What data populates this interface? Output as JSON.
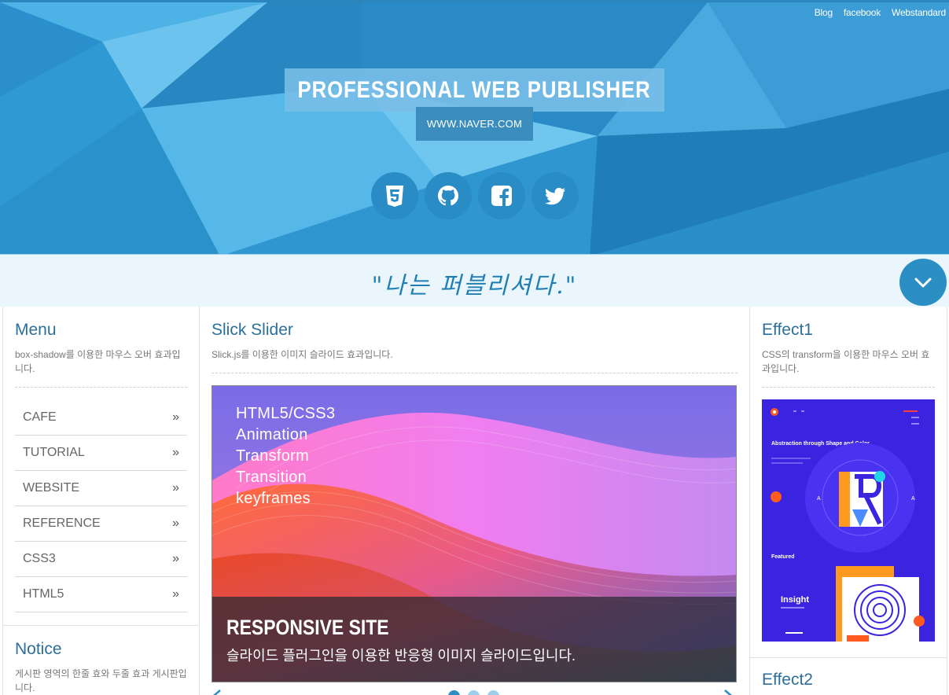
{
  "header": {
    "top_links": [
      "Blog",
      "facebook",
      "Webstandard"
    ],
    "title": "PROFESSIONAL WEB PUBLISHER",
    "url": "WWW.NAVER.COM",
    "socials": [
      "html5-icon",
      "github-icon",
      "facebook-icon",
      "twitter-icon"
    ]
  },
  "slogan": {
    "text": "\"나는 퍼블리셔다.\""
  },
  "menu": {
    "title": "Menu",
    "desc": "box-shadow를 이용한 마우스 오버 효과입니다.",
    "items": [
      "CAFE",
      "TUTORIAL",
      "WEBSITE",
      "REFERENCE",
      "CSS3",
      "HTML5"
    ],
    "arrow": "»"
  },
  "notice": {
    "title": "Notice",
    "desc": "게시판 영역의 한줄 효와 두줄 효과 게시판입니다."
  },
  "slick": {
    "title": "Slick Slider",
    "desc": "Slick.js를 이용한 이미지 슬라이드 효과입니다.",
    "lines": [
      "HTML5/CSS3",
      "Animation",
      "Transform",
      "Transition",
      "keyframes"
    ],
    "caption_title": "RESPONSIVE SITE",
    "caption_text": "슬라이드 플러그인을 이용한 반응형 이미지 슬라이드입니다.",
    "dots": 3,
    "active_dot": 0
  },
  "effect1": {
    "title": "Effect1",
    "desc": "CSS의 transform을 이용한 마우스 오버 효과입니다.",
    "thumb_heading": "Abstraction through Shape and Color",
    "thumb_featured": "Featured",
    "thumb_insight": "Insight"
  },
  "effect2": {
    "title": "Effect2"
  },
  "colors": {
    "brand": "#2b8fc4",
    "title": "#2c6f9b",
    "header_bg": "#3aa3dc",
    "slogan_bg": "#eaf6fc"
  }
}
